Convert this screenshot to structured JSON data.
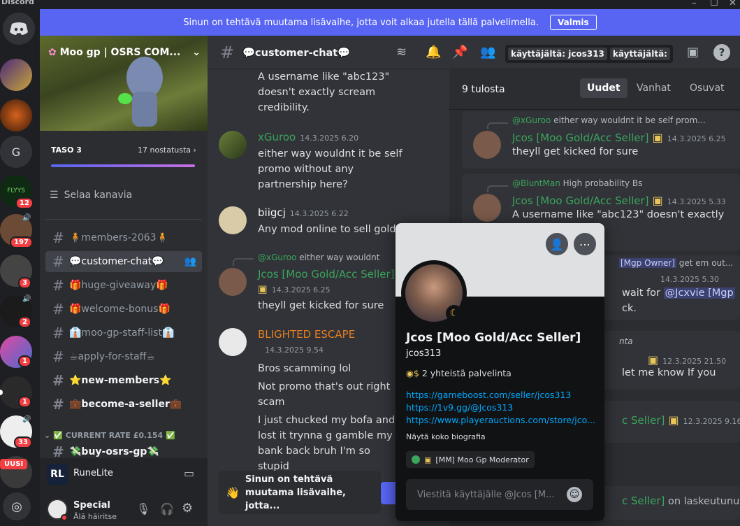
{
  "app": {
    "title": "Discord"
  },
  "notice": {
    "text": "Sinun on tehtävä muutama lisävaihe, jotta voit alkaa jutella tällä palvelimella.",
    "button": "Valmis"
  },
  "rail": {
    "badges": [
      "12",
      "197",
      "3",
      "2",
      "1",
      "1",
      "33"
    ],
    "g_label": "G",
    "flyys_label": "FLYYS",
    "new_label": "UUSI"
  },
  "server": {
    "name": "Moo gp | OSRS COM...",
    "level": "TASO 3",
    "boosts": "17 nostatusta",
    "browse": "Selaa kanavia",
    "channels": [
      {
        "name": "🧍members-2063🧍"
      },
      {
        "name": "💬customer-chat💬"
      },
      {
        "name": "🎁huge-giveaway🎁"
      },
      {
        "name": "🎁welcome-bonus🎁"
      },
      {
        "name": "👔moo-gp-staff-list👔"
      },
      {
        "name": "☕apply-for-staff☕"
      },
      {
        "name": "⭐new-members⭐"
      },
      {
        "name": "💼become-a-seller💼"
      },
      {
        "name": "💸buy-osrs-gp💸"
      }
    ],
    "category": "✅ CURRENT RATE £0.154 ✅"
  },
  "activity": {
    "name": "RuneLite"
  },
  "user": {
    "name": "Special",
    "status": "Älä häiritse"
  },
  "header": {
    "channel": "💬customer-chat💬",
    "search_tag1": "käyttäjältä: jcos313",
    "search_tag2": "käyttäjältä:"
  },
  "chat": {
    "messages": [
      {
        "text": "A username like \"abc123\" doesn't exactly scream credibility."
      },
      {
        "author": "xGuroo",
        "time": "14.3.2025 6.20",
        "text": "either way wouldnt it be self promo without any partnership here?"
      },
      {
        "author": "biigcj",
        "time": "14.3.2025 6.22",
        "text": "Any mod online to sell gold rn"
      },
      {
        "reply_author": "@xGuroo",
        "reply_text": "either way wouldnt",
        "author": "Jcos [Moo Gold/Acc Seller]",
        "time": "14.3.2025 6.25",
        "text": "theyll get kicked for sure"
      },
      {
        "author": "BLIGHTED ESCAPE",
        "time": "14.3.2025 9.54",
        "text1": "Bros scamming lol",
        "text2": "Not promo that's out right scam",
        "text3": "I just chucked  my bofa and lost it trynna g gamble my bank back bruh  I'm so stupid"
      }
    ],
    "bottom_notice": "Sinun on tehtävä muutama lisävaihe, jotta..."
  },
  "search": {
    "count": "9 tulosta",
    "tabs": [
      "Uudet",
      "Vanhat",
      "Osuvat"
    ],
    "results": [
      {
        "reply_author": "@xGuroo",
        "reply_text": "either way wouldnt it be self prom...",
        "author": "Jcos [Moo Gold/Acc Seller]",
        "time": "14.3.2025 6.25",
        "text": "theyll get kicked for sure"
      },
      {
        "reply_author": "@BluntMan",
        "reply_text": "High probability Bs",
        "author": "Jcos [Moo Gold/Acc Seller]",
        "time": "14.3.2025 5.33",
        "text": "A username like \"abc123\" doesn't exactly"
      },
      {
        "reply_tag": "[Mgp Owner]",
        "reply_text": "get em out...",
        "time": "14.3.2025 5.30",
        "text_a": "wait for",
        "mention": "@Jcxvie [Mgp",
        "text_b": "ck."
      },
      {
        "reply_text": "nta",
        "time": "12.3.2025 21.50",
        "text": "let me know If you"
      },
      {
        "author_tail": "c Seller]",
        "time": "12.3.2025 9.16"
      },
      {
        "author_tail": "c Seller]",
        "text": "on laskeutunut."
      }
    ]
  },
  "popup": {
    "name": "Jcos [Moo Gold/Acc Seller]",
    "username": "jcos313",
    "mutual": "2 yhteistä palvelinta",
    "links": [
      "https://gameboost.com/seller/jcos313",
      "https://1v9.gg/@Jcos313",
      "https://www.playerauctions.com/store/jco..."
    ],
    "bio_more": "Näytä koko biografia",
    "role": "[MM] Moo Gp Moderator",
    "message_placeholder": "Viestitä käyttäjälle @Jcos [M..."
  },
  "colors": {
    "blurple": "#5865f2",
    "green": "#3ba55c",
    "red": "#f23f43",
    "link": "#00a8fc"
  }
}
